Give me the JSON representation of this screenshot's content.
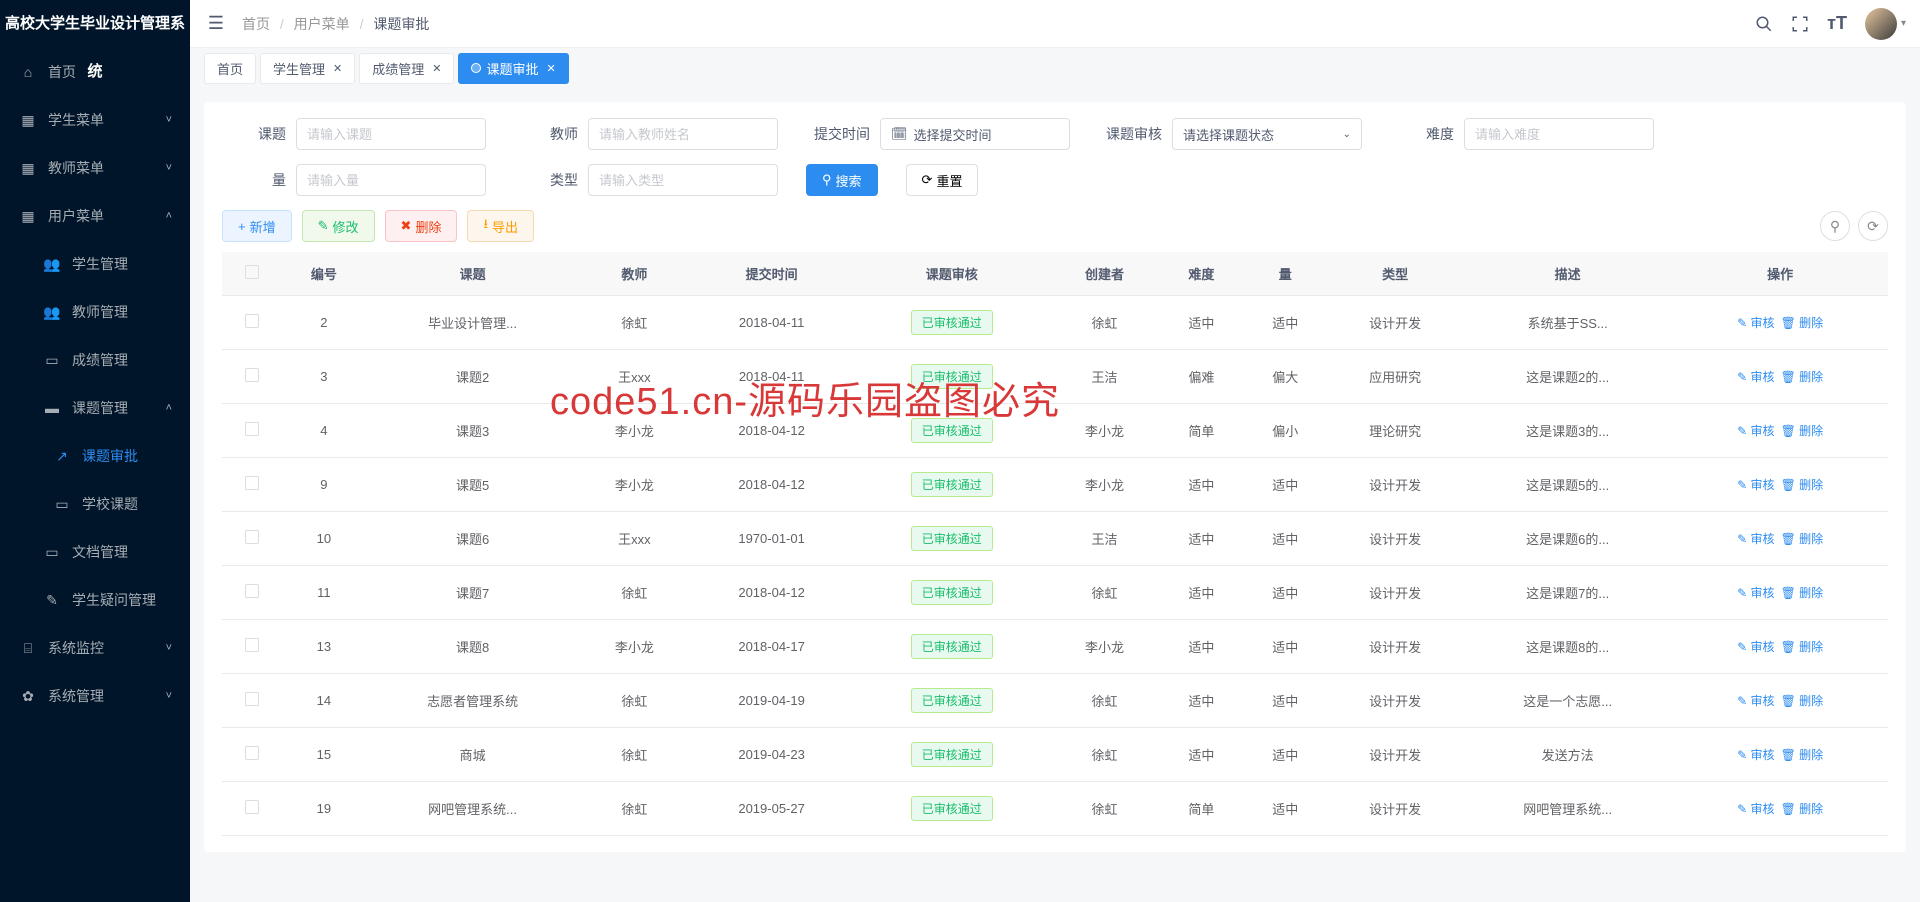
{
  "app_title": "高校大学生毕业设计管理系统",
  "breadcrumb": {
    "home": "首页",
    "mid": "用户菜单",
    "cur": "课题审批"
  },
  "sidebar": {
    "items": [
      {
        "icon": "⌂",
        "label": "首页",
        "arrow": false
      },
      {
        "icon": "▦",
        "label": "学生菜单",
        "arrow": true
      },
      {
        "icon": "▦",
        "label": "教师菜单",
        "arrow": true
      },
      {
        "icon": "▦",
        "label": "用户菜单",
        "arrow": true,
        "open": true,
        "children": [
          {
            "icon": "👥",
            "label": "学生管理"
          },
          {
            "icon": "👥",
            "label": "教师管理"
          },
          {
            "icon": "▭",
            "label": "成绩管理"
          },
          {
            "icon": "▬",
            "label": "课题管理",
            "open": true,
            "children": [
              {
                "icon": "↗",
                "label": "课题审批",
                "active": true
              },
              {
                "icon": "▭",
                "label": "学校课题"
              }
            ]
          },
          {
            "icon": "▭",
            "label": "文档管理"
          },
          {
            "icon": "✎",
            "label": "学生疑问管理"
          }
        ]
      },
      {
        "icon": "⌸",
        "label": "系统监控",
        "arrow": true
      },
      {
        "icon": "✿",
        "label": "系统管理",
        "arrow": true
      }
    ]
  },
  "tabs": [
    {
      "label": "首页",
      "closable": false
    },
    {
      "label": "学生管理",
      "closable": true
    },
    {
      "label": "成绩管理",
      "closable": true
    },
    {
      "label": "课题审批",
      "closable": true,
      "active": true
    }
  ],
  "filters": {
    "topic": {
      "label": "课题",
      "placeholder": "请输入课题"
    },
    "teacher": {
      "label": "教师",
      "placeholder": "请输入教师姓名"
    },
    "submit_time": {
      "label": "提交时间",
      "placeholder": "选择提交时间"
    },
    "review": {
      "label": "课题审核",
      "placeholder": "请选择课题状态"
    },
    "difficulty": {
      "label": "难度",
      "placeholder": "请输入难度"
    },
    "amount": {
      "label": "量",
      "placeholder": "请输入量"
    },
    "type": {
      "label": "类型",
      "placeholder": "请输入类型"
    }
  },
  "buttons": {
    "search": "搜索",
    "reset": "重置",
    "add": "新增",
    "edit": "修改",
    "delete": "删除",
    "export": "导出",
    "audit": "审核",
    "row_delete": "删除"
  },
  "table": {
    "headers": [
      "",
      "编号",
      "课题",
      "教师",
      "提交时间",
      "课题审核",
      "创建者",
      "难度",
      "量",
      "类型",
      "描述",
      "操作"
    ],
    "status_label": "已审核通过",
    "rows": [
      {
        "id": "2",
        "topic": "毕业设计管理...",
        "teacher": "徐虹",
        "time": "2018-04-11",
        "creator": "徐虹",
        "diff": "适中",
        "amount": "适中",
        "type": "设计开发",
        "desc": "系统基于SS..."
      },
      {
        "id": "3",
        "topic": "课题2",
        "teacher": "王xxx",
        "time": "2018-04-11",
        "creator": "王洁",
        "diff": "偏难",
        "amount": "偏大",
        "type": "应用研究",
        "desc": "这是课题2的..."
      },
      {
        "id": "4",
        "topic": "课题3",
        "teacher": "李小龙",
        "time": "2018-04-12",
        "creator": "李小龙",
        "diff": "简单",
        "amount": "偏小",
        "type": "理论研究",
        "desc": "这是课题3的..."
      },
      {
        "id": "9",
        "topic": "课题5",
        "teacher": "李小龙",
        "time": "2018-04-12",
        "creator": "李小龙",
        "diff": "适中",
        "amount": "适中",
        "type": "设计开发",
        "desc": "这是课题5的..."
      },
      {
        "id": "10",
        "topic": "课题6",
        "teacher": "王xxx",
        "time": "1970-01-01",
        "creator": "王洁",
        "diff": "适中",
        "amount": "适中",
        "type": "设计开发",
        "desc": "这是课题6的..."
      },
      {
        "id": "11",
        "topic": "课题7",
        "teacher": "徐虹",
        "time": "2018-04-12",
        "creator": "徐虹",
        "diff": "适中",
        "amount": "适中",
        "type": "设计开发",
        "desc": "这是课题7的..."
      },
      {
        "id": "13",
        "topic": "课题8",
        "teacher": "李小龙",
        "time": "2018-04-17",
        "creator": "李小龙",
        "diff": "适中",
        "amount": "适中",
        "type": "设计开发",
        "desc": "这是课题8的..."
      },
      {
        "id": "14",
        "topic": "志愿者管理系统",
        "teacher": "徐虹",
        "time": "2019-04-19",
        "creator": "徐虹",
        "diff": "适中",
        "amount": "适中",
        "type": "设计开发",
        "desc": "这是一个志愿..."
      },
      {
        "id": "15",
        "topic": "商城",
        "teacher": "徐虹",
        "time": "2019-04-23",
        "creator": "徐虹",
        "diff": "适中",
        "amount": "适中",
        "type": "设计开发",
        "desc": "发送方法"
      },
      {
        "id": "19",
        "topic": "网吧管理系统...",
        "teacher": "徐虹",
        "time": "2019-05-27",
        "creator": "徐虹",
        "diff": "简单",
        "amount": "适中",
        "type": "设计开发",
        "desc": "网吧管理系统..."
      }
    ]
  },
  "watermark": "code51.cn-源码乐园盗图必究"
}
